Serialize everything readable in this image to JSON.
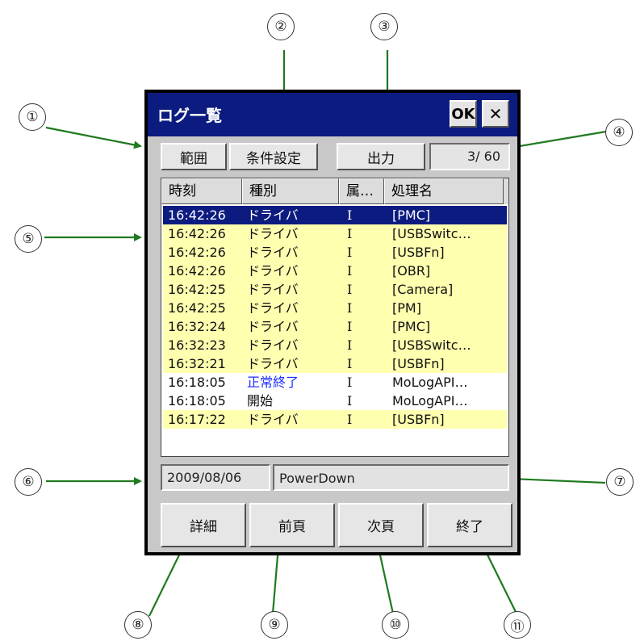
{
  "window": {
    "title": "ログ一覧",
    "ok_label": "OK",
    "close_label": "✕"
  },
  "toolbar": {
    "range_label": "範囲",
    "filter_label": "条件設定",
    "output_label": "出力",
    "page_count": "3/ 60"
  },
  "list": {
    "columns": [
      "時刻",
      "種別",
      "属…",
      "処理名"
    ],
    "rows": [
      {
        "time": "16:42:26",
        "type": "ドライバ",
        "attr": "I",
        "name": "[PMC]",
        "state": "selected"
      },
      {
        "time": "16:42:26",
        "type": "ドライバ",
        "attr": "I",
        "name": "[USBSwitc…",
        "state": "highlight"
      },
      {
        "time": "16:42:26",
        "type": "ドライバ",
        "attr": "I",
        "name": "[USBFn]",
        "state": "highlight"
      },
      {
        "time": "16:42:26",
        "type": "ドライバ",
        "attr": "I",
        "name": "[OBR]",
        "state": "highlight"
      },
      {
        "time": "16:42:25",
        "type": "ドライバ",
        "attr": "I",
        "name": "[Camera]",
        "state": "highlight"
      },
      {
        "time": "16:42:25",
        "type": "ドライバ",
        "attr": "I",
        "name": "[PM]",
        "state": "highlight"
      },
      {
        "time": "16:32:24",
        "type": "ドライバ",
        "attr": "I",
        "name": "[PMC]",
        "state": "highlight"
      },
      {
        "time": "16:32:23",
        "type": "ドライバ",
        "attr": "I",
        "name": "[USBSwitc…",
        "state": "highlight"
      },
      {
        "time": "16:32:21",
        "type": "ドライバ",
        "attr": "I",
        "name": "[USBFn]",
        "state": "highlight"
      },
      {
        "time": "16:18:05",
        "type": "正常終了",
        "attr": "I",
        "name": "MoLogAPI…",
        "state": "normal-blue"
      },
      {
        "time": "16:18:05",
        "type": "開始",
        "attr": "I",
        "name": "MoLogAPI…",
        "state": "normal"
      },
      {
        "time": "16:17:22",
        "type": "ドライバ",
        "attr": "I",
        "name": "[USBFn]",
        "state": "highlight"
      }
    ]
  },
  "status": {
    "date": "2009/08/06",
    "message": "PowerDown"
  },
  "bottom": {
    "detail_label": "詳細",
    "prev_label": "前頁",
    "next_label": "次頁",
    "end_label": "終了"
  },
  "callouts": [
    "①",
    "②",
    "③",
    "④",
    "⑤",
    "⑥",
    "⑦",
    "⑧",
    "⑨",
    "⑩",
    "⑪"
  ],
  "colors": {
    "titlebar": "#0c1b80",
    "selected_row": "#0c1b80",
    "highlight_row": "#ffffb0",
    "blue_text": "#1a2cff",
    "arrow": "#1f7a1f"
  }
}
